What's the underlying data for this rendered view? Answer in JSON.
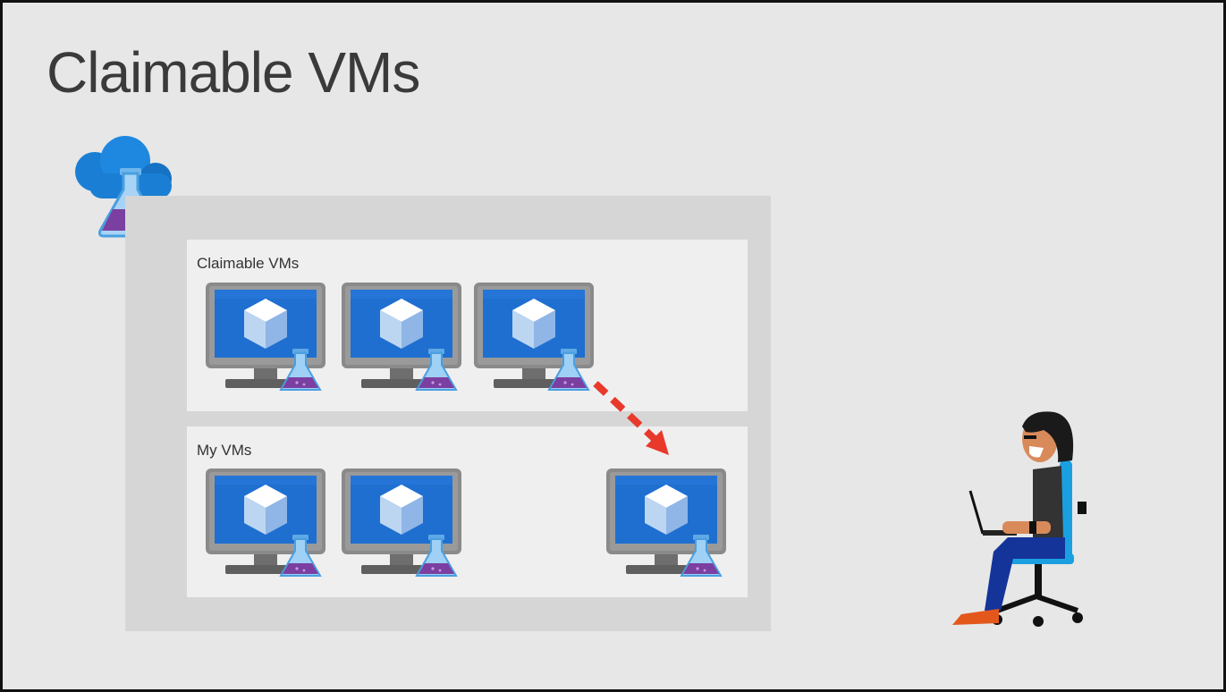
{
  "slide": {
    "title": "Claimable VMs"
  },
  "panels": {
    "claimable_label": "Claimable VMs",
    "my_vms_label": "My VMs"
  },
  "colors": {
    "monitor_frame": "#7a7a7a",
    "screen": "#1e6fd0",
    "flask_purple": "#7a3ea0",
    "arrow": "#e8392b",
    "cloud": "#1a7fd4"
  },
  "icons": [
    "devtest-labs-logo",
    "virtual-machine-icon",
    "claim-arrow",
    "developer-person"
  ]
}
